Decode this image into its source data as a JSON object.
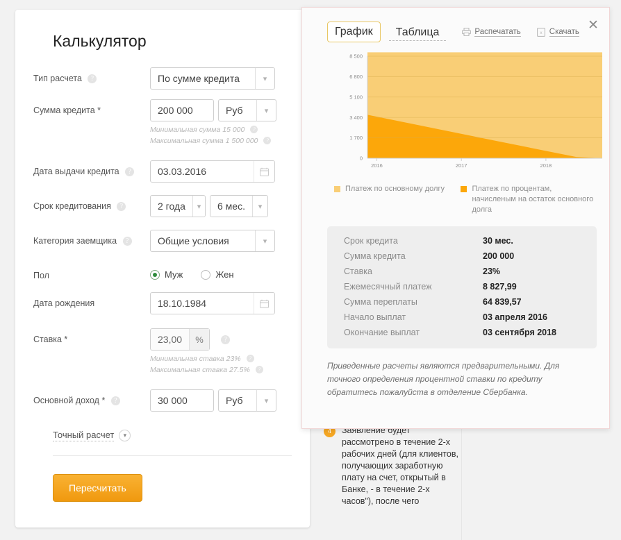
{
  "calculator": {
    "title": "Калькулятор",
    "fields": [
      {
        "label": "Тип расчета",
        "help": "?",
        "value": "По сумме кредита"
      },
      {
        "label": "Сумма кредита *",
        "value": "200 000",
        "unit": "Руб",
        "hints": [
          "Минимальная сумма 15 000",
          "Максимальная сумма 1 500 000"
        ]
      },
      {
        "label": "Дата выдачи кредита",
        "help": "?",
        "value": "03.03.2016"
      },
      {
        "label": "Срок кредитования",
        "help": "?",
        "value": "2 года",
        "value2": "6 мес."
      },
      {
        "label": "Категория заемщика",
        "help": "?",
        "value": "Общие условия"
      },
      {
        "label": "Пол",
        "options": [
          "Муж",
          "Жен"
        ],
        "selected": "Муж"
      },
      {
        "label": "Дата рождения",
        "value": "18.10.1984"
      },
      {
        "label": "Ставка *",
        "value": "23,00",
        "unit": "%",
        "hints": [
          "Минимальная ставка 23%",
          "Максимальная ставка 27.5%"
        ]
      },
      {
        "label": "Основной доход *",
        "help": "?",
        "value": "30 000",
        "unit": "Руб"
      }
    ],
    "exact_calc_link": "Точный расчет",
    "recalculate_button": "Пересчитать"
  },
  "modal": {
    "close_icon": "close-icon",
    "tabs": [
      {
        "label": "График",
        "active": true
      },
      {
        "label": "Таблица",
        "active": false
      }
    ],
    "tools": [
      {
        "label": "Распечатать",
        "icon": "printer-icon"
      },
      {
        "label": "Скачать",
        "icon": "excel-file-icon"
      }
    ],
    "legend": [
      {
        "label": "Платеж по основному долгу",
        "color": "#f9ce76"
      },
      {
        "label": "Платеж по процентам, начисленым на остаток основного долга",
        "color": "#fca70a"
      }
    ],
    "summary": [
      {
        "key": "Срок кредита",
        "value": "30 мес."
      },
      {
        "key": "Сумма кредита",
        "value": "200 000"
      },
      {
        "key": "Ставка",
        "value": "23%"
      },
      {
        "key": "Ежемесячный платеж",
        "value": "8 827,99"
      },
      {
        "key": "Сумма переплаты",
        "value": "64 839,57"
      },
      {
        "key": "Начало выплат",
        "value": "03 апреля 2016"
      },
      {
        "key": "Окончание выплат",
        "value": "03 сентября 2018"
      }
    ],
    "disclaimer": "Приведенные расчеты являются предварительными. Для точного определения процентной ставки по кредиту обратитесь пожалуйста в отделение Сбербанка."
  },
  "background": {
    "step_number": "4",
    "step_text": "Заявление будет рассмотрено в течение 2-х рабочих дней (для клиентов, получающих заработную плату на счет, открытый в Банке, - в течение 2-х часов\"), после чего"
  },
  "chart_data": {
    "type": "area",
    "title": "",
    "xlabel": "",
    "ylabel": "",
    "x": [
      "2016",
      "2017",
      "2018"
    ],
    "x_tick_positions": [
      0.04,
      0.4,
      0.76
    ],
    "ylim": [
      0,
      8500
    ],
    "yticks": [
      0,
      1700,
      3400,
      5100,
      6800,
      8500
    ],
    "ytick_labels": [
      "0",
      "1 700",
      "3 400",
      "5 100",
      "6 800",
      "8 500"
    ],
    "grid": true,
    "legend_position": "bottom",
    "stacked": true,
    "series": [
      {
        "name": "Платеж по процентам, начисленым на остаток основного долга",
        "color": "#fca70a",
        "values": [
          3620,
          3180,
          2740,
          2300,
          1860,
          1420,
          980,
          540,
          110,
          0
        ]
      },
      {
        "name": "Платеж по основному долгу",
        "color": "#f9ce76",
        "values": [
          5208,
          5648,
          6088,
          6528,
          6968,
          7408,
          7848,
          8288,
          8718,
          8828
        ]
      }
    ],
    "total_constant": 8828
  }
}
